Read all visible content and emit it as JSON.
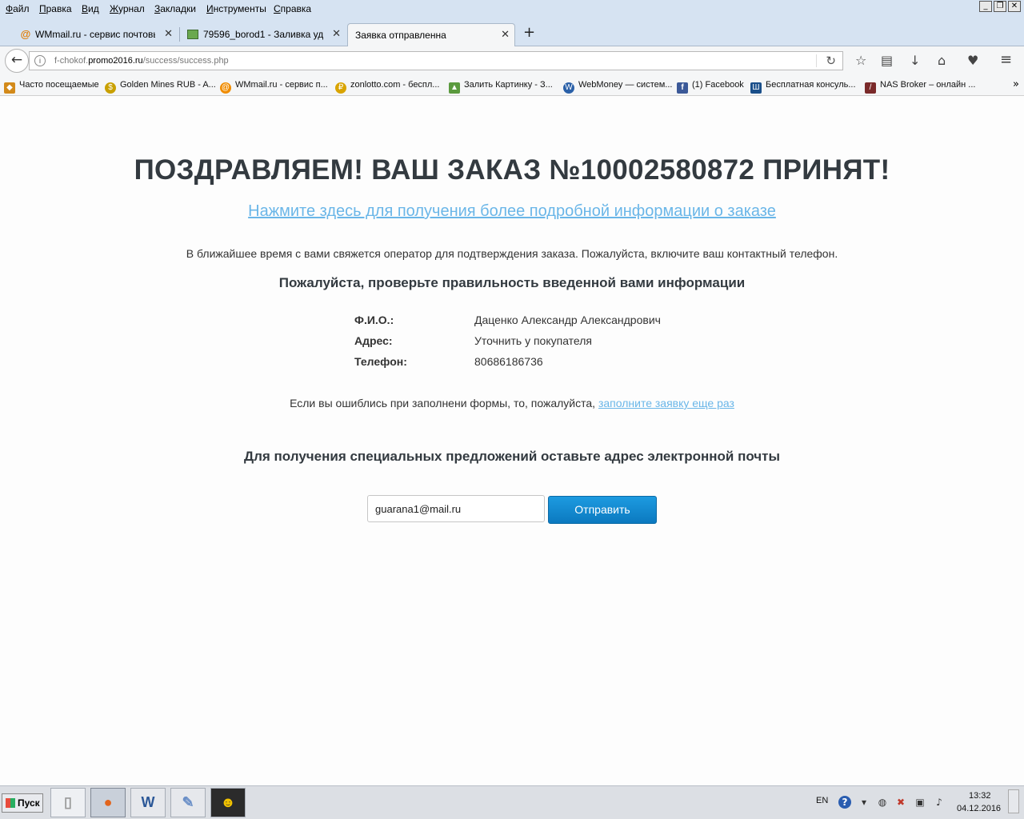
{
  "menubar": {
    "items": [
      "Файл",
      "Правка",
      "Вид",
      "Журнал",
      "Закладки",
      "Инструменты",
      "Справка"
    ],
    "underline": [
      "Ф",
      "П",
      "В",
      "Ж",
      "З",
      "И",
      "С"
    ],
    "window_buttons": [
      "_",
      "❐",
      "✕"
    ]
  },
  "tabs": [
    {
      "title": "WMmail.ru - сервис почтовы...",
      "icon": "at-icon"
    },
    {
      "title": "79596_borod1 - Заливка уд...",
      "icon": "image-icon"
    },
    {
      "title": "Заявка отправленна",
      "icon": ""
    }
  ],
  "tab_close": "✕",
  "new_tab": "+",
  "nav": {
    "back": "←",
    "url_prefix": "f-chokof.",
    "url_host": "promo2016.ru",
    "url_path": "/success/success.php",
    "reload": "↻",
    "toolbar_icons": [
      "☆",
      "▤",
      "↓",
      "⌂",
      "♥",
      "≡"
    ]
  },
  "bookmarks": [
    {
      "label": "Часто посещаемые",
      "color": "#d38a1a",
      "glyph": "◆"
    },
    {
      "label": "Golden Mines RUB - A...",
      "color": "#c9a000",
      "glyph": "$"
    },
    {
      "label": "WMmail.ru - сервис п...",
      "color": "#f08c00",
      "glyph": "@"
    },
    {
      "label": "zonlotto.com - беспл...",
      "color": "#d9a400",
      "glyph": "₽"
    },
    {
      "label": "Залить Картинку - З...",
      "color": "#5b9a3e",
      "glyph": "▲"
    },
    {
      "label": "WebMoney — систем...",
      "color": "#2a60a8",
      "glyph": "W"
    },
    {
      "label": "(1) Facebook",
      "color": "#3b5998",
      "glyph": "f"
    },
    {
      "label": "Бесплатная консуль...",
      "color": "#1a4f8a",
      "glyph": "Ш"
    },
    {
      "label": "NAS Broker – онлайн ...",
      "color": "#7a2a2a",
      "glyph": "/"
    }
  ],
  "bookmarks_more": "»",
  "page": {
    "title": "ПОЗДРАВЛЯЕМ! ВАШ ЗАКАЗ №10002580872 ПРИНЯТ!",
    "more_link": "Нажмите здесь для получения более подробной информации о заказе",
    "notice": "В ближайшее время с вами свяжется оператор для подтверждения заказа. Пожалуйста, включите ваш контактный телефон.",
    "check_heading": "Пожалуйста, проверьте правильность введенной вами информации",
    "info": [
      {
        "label": "Ф.И.О.:",
        "value": "Даценко Александр Александрович"
      },
      {
        "label": "Адрес:",
        "value": "Уточнить у покупателя"
      },
      {
        "label": "Телефон:",
        "value": "80686186736"
      }
    ],
    "retry_text": "Если вы ошиблись при заполнени формы, то, пожалуйста,",
    "retry_link": "заполните заявку еще раз",
    "offer_heading": "Для получения специальных предложений оставьте адрес электронной почты",
    "email_value": "guarana1@mail.ru",
    "send_label": "Отправить",
    "accent_color": "#1a8ad4",
    "link_color": "#6ab6e8"
  },
  "taskbar": {
    "start_label": "Пуск",
    "apps": [
      {
        "name": "blank-document-icon",
        "glyph": "▯"
      },
      {
        "name": "firefox-icon",
        "glyph": "●"
      },
      {
        "name": "word-icon",
        "glyph": "W"
      },
      {
        "name": "paint-icon",
        "glyph": "✎"
      },
      {
        "name": "cyberghost-icon",
        "glyph": "☻"
      }
    ],
    "lang": "EN",
    "help": "?",
    "time": "13:32",
    "date": "04.12.2016"
  }
}
